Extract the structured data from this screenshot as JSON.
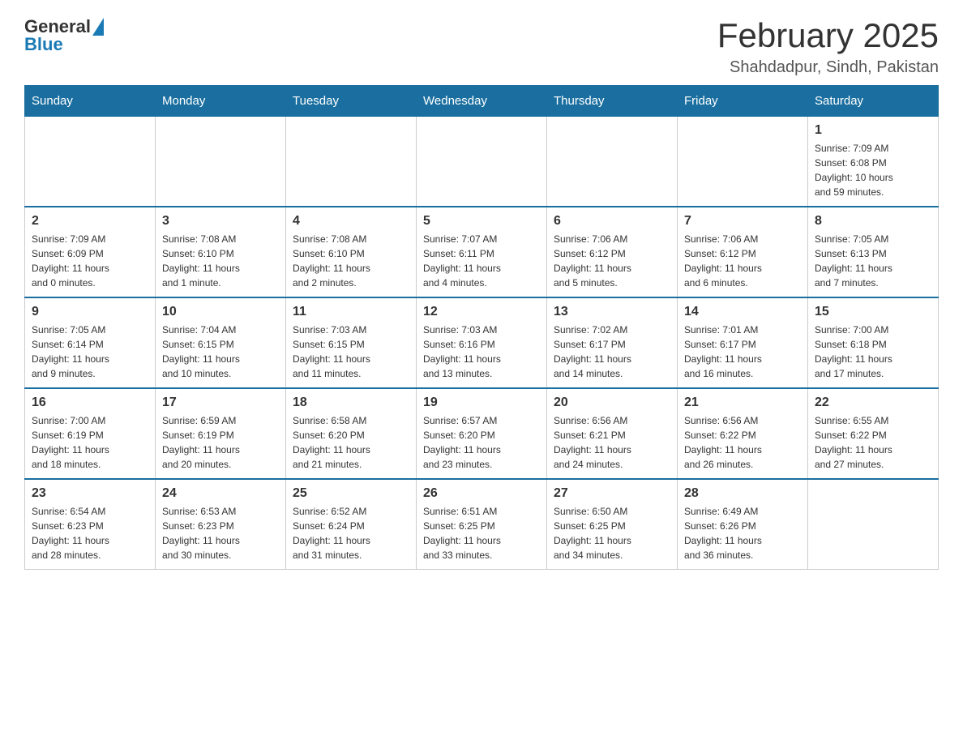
{
  "header": {
    "logo_general": "General",
    "logo_blue": "Blue",
    "month_title": "February 2025",
    "location": "Shahdadpur, Sindh, Pakistan"
  },
  "weekdays": [
    "Sunday",
    "Monday",
    "Tuesday",
    "Wednesday",
    "Thursday",
    "Friday",
    "Saturday"
  ],
  "weeks": [
    [
      {
        "day": "",
        "info": ""
      },
      {
        "day": "",
        "info": ""
      },
      {
        "day": "",
        "info": ""
      },
      {
        "day": "",
        "info": ""
      },
      {
        "day": "",
        "info": ""
      },
      {
        "day": "",
        "info": ""
      },
      {
        "day": "1",
        "info": "Sunrise: 7:09 AM\nSunset: 6:08 PM\nDaylight: 10 hours\nand 59 minutes."
      }
    ],
    [
      {
        "day": "2",
        "info": "Sunrise: 7:09 AM\nSunset: 6:09 PM\nDaylight: 11 hours\nand 0 minutes."
      },
      {
        "day": "3",
        "info": "Sunrise: 7:08 AM\nSunset: 6:10 PM\nDaylight: 11 hours\nand 1 minute."
      },
      {
        "day": "4",
        "info": "Sunrise: 7:08 AM\nSunset: 6:10 PM\nDaylight: 11 hours\nand 2 minutes."
      },
      {
        "day": "5",
        "info": "Sunrise: 7:07 AM\nSunset: 6:11 PM\nDaylight: 11 hours\nand 4 minutes."
      },
      {
        "day": "6",
        "info": "Sunrise: 7:06 AM\nSunset: 6:12 PM\nDaylight: 11 hours\nand 5 minutes."
      },
      {
        "day": "7",
        "info": "Sunrise: 7:06 AM\nSunset: 6:12 PM\nDaylight: 11 hours\nand 6 minutes."
      },
      {
        "day": "8",
        "info": "Sunrise: 7:05 AM\nSunset: 6:13 PM\nDaylight: 11 hours\nand 7 minutes."
      }
    ],
    [
      {
        "day": "9",
        "info": "Sunrise: 7:05 AM\nSunset: 6:14 PM\nDaylight: 11 hours\nand 9 minutes."
      },
      {
        "day": "10",
        "info": "Sunrise: 7:04 AM\nSunset: 6:15 PM\nDaylight: 11 hours\nand 10 minutes."
      },
      {
        "day": "11",
        "info": "Sunrise: 7:03 AM\nSunset: 6:15 PM\nDaylight: 11 hours\nand 11 minutes."
      },
      {
        "day": "12",
        "info": "Sunrise: 7:03 AM\nSunset: 6:16 PM\nDaylight: 11 hours\nand 13 minutes."
      },
      {
        "day": "13",
        "info": "Sunrise: 7:02 AM\nSunset: 6:17 PM\nDaylight: 11 hours\nand 14 minutes."
      },
      {
        "day": "14",
        "info": "Sunrise: 7:01 AM\nSunset: 6:17 PM\nDaylight: 11 hours\nand 16 minutes."
      },
      {
        "day": "15",
        "info": "Sunrise: 7:00 AM\nSunset: 6:18 PM\nDaylight: 11 hours\nand 17 minutes."
      }
    ],
    [
      {
        "day": "16",
        "info": "Sunrise: 7:00 AM\nSunset: 6:19 PM\nDaylight: 11 hours\nand 18 minutes."
      },
      {
        "day": "17",
        "info": "Sunrise: 6:59 AM\nSunset: 6:19 PM\nDaylight: 11 hours\nand 20 minutes."
      },
      {
        "day": "18",
        "info": "Sunrise: 6:58 AM\nSunset: 6:20 PM\nDaylight: 11 hours\nand 21 minutes."
      },
      {
        "day": "19",
        "info": "Sunrise: 6:57 AM\nSunset: 6:20 PM\nDaylight: 11 hours\nand 23 minutes."
      },
      {
        "day": "20",
        "info": "Sunrise: 6:56 AM\nSunset: 6:21 PM\nDaylight: 11 hours\nand 24 minutes."
      },
      {
        "day": "21",
        "info": "Sunrise: 6:56 AM\nSunset: 6:22 PM\nDaylight: 11 hours\nand 26 minutes."
      },
      {
        "day": "22",
        "info": "Sunrise: 6:55 AM\nSunset: 6:22 PM\nDaylight: 11 hours\nand 27 minutes."
      }
    ],
    [
      {
        "day": "23",
        "info": "Sunrise: 6:54 AM\nSunset: 6:23 PM\nDaylight: 11 hours\nand 28 minutes."
      },
      {
        "day": "24",
        "info": "Sunrise: 6:53 AM\nSunset: 6:23 PM\nDaylight: 11 hours\nand 30 minutes."
      },
      {
        "day": "25",
        "info": "Sunrise: 6:52 AM\nSunset: 6:24 PM\nDaylight: 11 hours\nand 31 minutes."
      },
      {
        "day": "26",
        "info": "Sunrise: 6:51 AM\nSunset: 6:25 PM\nDaylight: 11 hours\nand 33 minutes."
      },
      {
        "day": "27",
        "info": "Sunrise: 6:50 AM\nSunset: 6:25 PM\nDaylight: 11 hours\nand 34 minutes."
      },
      {
        "day": "28",
        "info": "Sunrise: 6:49 AM\nSunset: 6:26 PM\nDaylight: 11 hours\nand 36 minutes."
      },
      {
        "day": "",
        "info": ""
      }
    ]
  ]
}
